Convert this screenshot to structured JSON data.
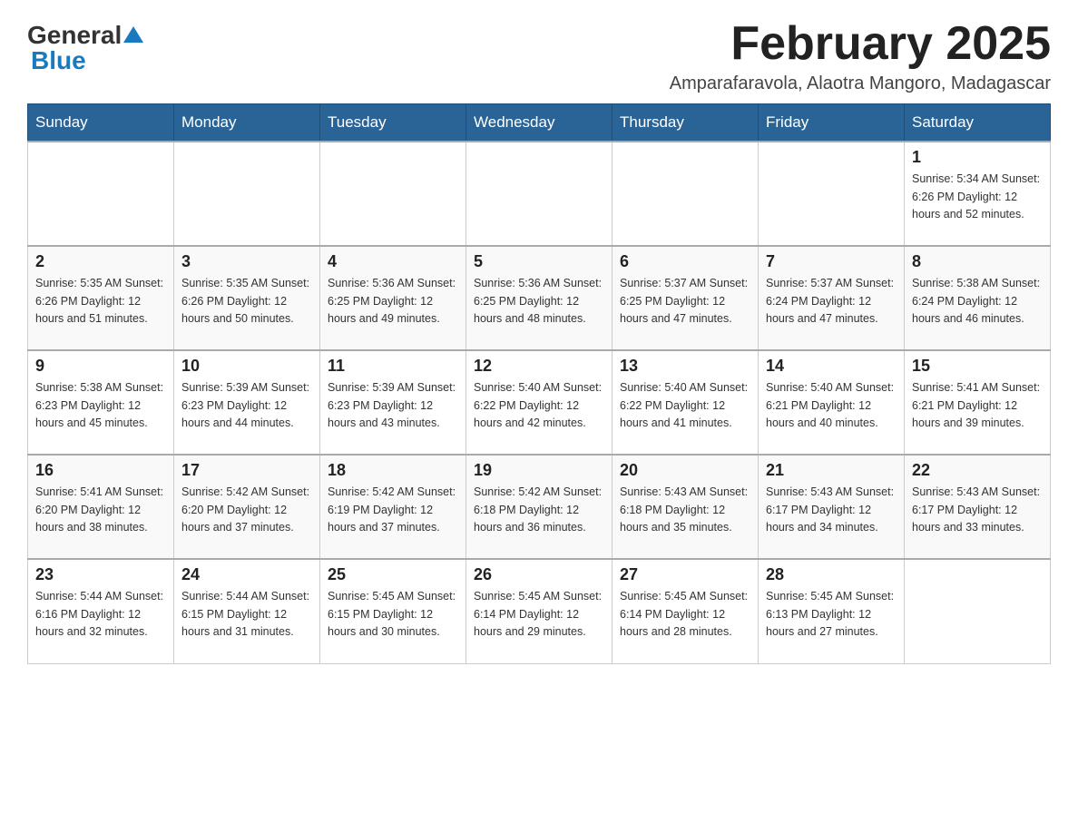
{
  "header": {
    "logo_general": "General",
    "logo_blue": "Blue",
    "title": "February 2025",
    "subtitle": "Amparafaravola, Alaotra Mangoro, Madagascar"
  },
  "days_of_week": [
    "Sunday",
    "Monday",
    "Tuesday",
    "Wednesday",
    "Thursday",
    "Friday",
    "Saturday"
  ],
  "weeks": [
    [
      {
        "day": "",
        "info": ""
      },
      {
        "day": "",
        "info": ""
      },
      {
        "day": "",
        "info": ""
      },
      {
        "day": "",
        "info": ""
      },
      {
        "day": "",
        "info": ""
      },
      {
        "day": "",
        "info": ""
      },
      {
        "day": "1",
        "info": "Sunrise: 5:34 AM\nSunset: 6:26 PM\nDaylight: 12 hours and 52 minutes."
      }
    ],
    [
      {
        "day": "2",
        "info": "Sunrise: 5:35 AM\nSunset: 6:26 PM\nDaylight: 12 hours and 51 minutes."
      },
      {
        "day": "3",
        "info": "Sunrise: 5:35 AM\nSunset: 6:26 PM\nDaylight: 12 hours and 50 minutes."
      },
      {
        "day": "4",
        "info": "Sunrise: 5:36 AM\nSunset: 6:25 PM\nDaylight: 12 hours and 49 minutes."
      },
      {
        "day": "5",
        "info": "Sunrise: 5:36 AM\nSunset: 6:25 PM\nDaylight: 12 hours and 48 minutes."
      },
      {
        "day": "6",
        "info": "Sunrise: 5:37 AM\nSunset: 6:25 PM\nDaylight: 12 hours and 47 minutes."
      },
      {
        "day": "7",
        "info": "Sunrise: 5:37 AM\nSunset: 6:24 PM\nDaylight: 12 hours and 47 minutes."
      },
      {
        "day": "8",
        "info": "Sunrise: 5:38 AM\nSunset: 6:24 PM\nDaylight: 12 hours and 46 minutes."
      }
    ],
    [
      {
        "day": "9",
        "info": "Sunrise: 5:38 AM\nSunset: 6:23 PM\nDaylight: 12 hours and 45 minutes."
      },
      {
        "day": "10",
        "info": "Sunrise: 5:39 AM\nSunset: 6:23 PM\nDaylight: 12 hours and 44 minutes."
      },
      {
        "day": "11",
        "info": "Sunrise: 5:39 AM\nSunset: 6:23 PM\nDaylight: 12 hours and 43 minutes."
      },
      {
        "day": "12",
        "info": "Sunrise: 5:40 AM\nSunset: 6:22 PM\nDaylight: 12 hours and 42 minutes."
      },
      {
        "day": "13",
        "info": "Sunrise: 5:40 AM\nSunset: 6:22 PM\nDaylight: 12 hours and 41 minutes."
      },
      {
        "day": "14",
        "info": "Sunrise: 5:40 AM\nSunset: 6:21 PM\nDaylight: 12 hours and 40 minutes."
      },
      {
        "day": "15",
        "info": "Sunrise: 5:41 AM\nSunset: 6:21 PM\nDaylight: 12 hours and 39 minutes."
      }
    ],
    [
      {
        "day": "16",
        "info": "Sunrise: 5:41 AM\nSunset: 6:20 PM\nDaylight: 12 hours and 38 minutes."
      },
      {
        "day": "17",
        "info": "Sunrise: 5:42 AM\nSunset: 6:20 PM\nDaylight: 12 hours and 37 minutes."
      },
      {
        "day": "18",
        "info": "Sunrise: 5:42 AM\nSunset: 6:19 PM\nDaylight: 12 hours and 37 minutes."
      },
      {
        "day": "19",
        "info": "Sunrise: 5:42 AM\nSunset: 6:18 PM\nDaylight: 12 hours and 36 minutes."
      },
      {
        "day": "20",
        "info": "Sunrise: 5:43 AM\nSunset: 6:18 PM\nDaylight: 12 hours and 35 minutes."
      },
      {
        "day": "21",
        "info": "Sunrise: 5:43 AM\nSunset: 6:17 PM\nDaylight: 12 hours and 34 minutes."
      },
      {
        "day": "22",
        "info": "Sunrise: 5:43 AM\nSunset: 6:17 PM\nDaylight: 12 hours and 33 minutes."
      }
    ],
    [
      {
        "day": "23",
        "info": "Sunrise: 5:44 AM\nSunset: 6:16 PM\nDaylight: 12 hours and 32 minutes."
      },
      {
        "day": "24",
        "info": "Sunrise: 5:44 AM\nSunset: 6:15 PM\nDaylight: 12 hours and 31 minutes."
      },
      {
        "day": "25",
        "info": "Sunrise: 5:45 AM\nSunset: 6:15 PM\nDaylight: 12 hours and 30 minutes."
      },
      {
        "day": "26",
        "info": "Sunrise: 5:45 AM\nSunset: 6:14 PM\nDaylight: 12 hours and 29 minutes."
      },
      {
        "day": "27",
        "info": "Sunrise: 5:45 AM\nSunset: 6:14 PM\nDaylight: 12 hours and 28 minutes."
      },
      {
        "day": "28",
        "info": "Sunrise: 5:45 AM\nSunset: 6:13 PM\nDaylight: 12 hours and 27 minutes."
      },
      {
        "day": "",
        "info": ""
      }
    ]
  ]
}
